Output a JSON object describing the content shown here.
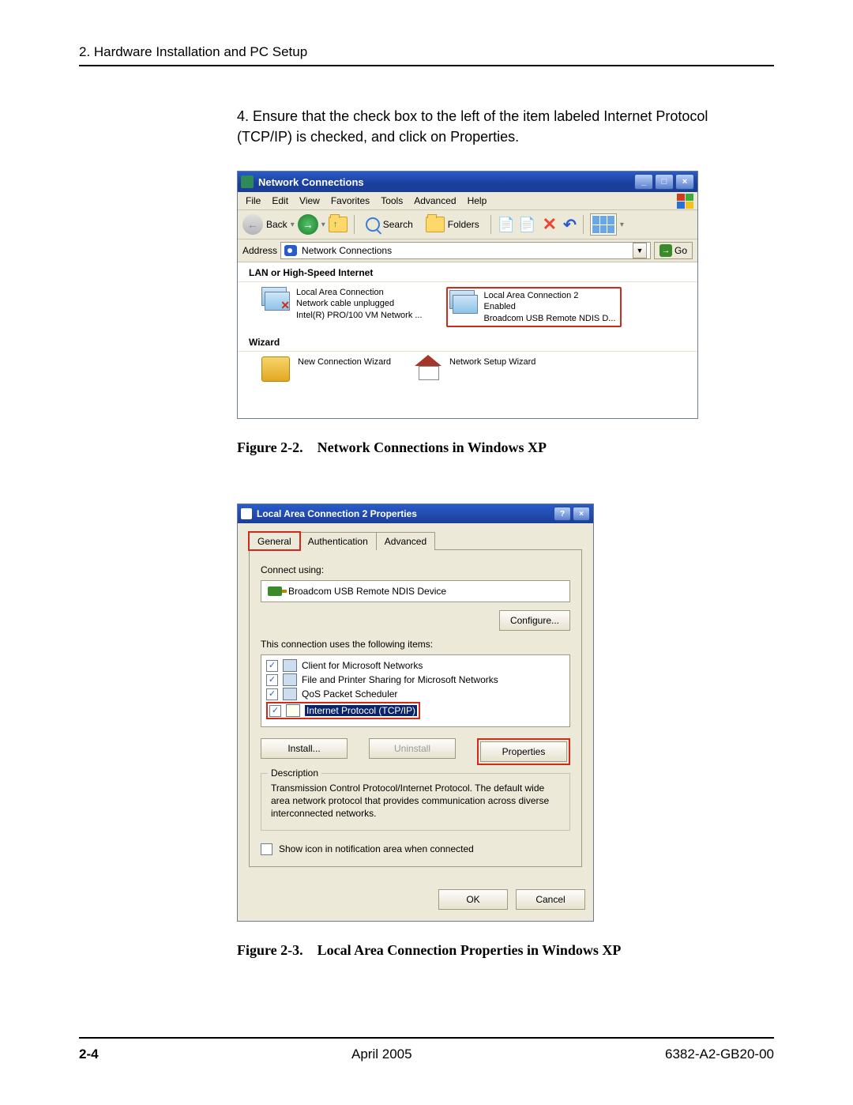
{
  "header": {
    "text": "2. Hardware Installation and PC Setup"
  },
  "instruction": {
    "number": "4.",
    "text": "Ensure that the check box to the left of the item labeled Internet Protocol (TCP/IP) is checked, and click on Properties."
  },
  "nc": {
    "title": "Network Connections",
    "menu": {
      "file": "File",
      "edit": "Edit",
      "view": "View",
      "favorites": "Favorites",
      "tools": "Tools",
      "advanced": "Advanced",
      "help": "Help"
    },
    "toolbar": {
      "back": "Back",
      "search": "Search",
      "folders": "Folders"
    },
    "address": {
      "label": "Address",
      "value": "Network Connections",
      "go": "Go"
    },
    "section_lan": "LAN or High-Speed Internet",
    "lan1": {
      "name": "Local Area Connection",
      "status": "Network cable unplugged",
      "device": "Intel(R) PRO/100 VM Network ..."
    },
    "lan2": {
      "name": "Local Area Connection 2",
      "status": "Enabled",
      "device": "Broadcom USB Remote NDIS D..."
    },
    "section_wizard": "Wizard",
    "wiz_new": "New Connection Wizard",
    "wiz_net": "Network Setup Wizard"
  },
  "caption1": {
    "label": "Figure 2-2.",
    "text": "Network Connections in Windows XP"
  },
  "prop": {
    "title": "Local Area Connection 2 Properties",
    "tabs": {
      "general": "General",
      "auth": "Authentication",
      "adv": "Advanced"
    },
    "connect_using": "Connect using:",
    "adapter": "Broadcom USB Remote NDIS Device",
    "configure": "Configure...",
    "items_label": "This connection uses the following items:",
    "items": {
      "client": "Client for Microsoft Networks",
      "fps": "File and Printer Sharing for Microsoft Networks",
      "qos": "QoS Packet Scheduler",
      "tcpip": "Internet Protocol (TCP/IP)"
    },
    "install": "Install...",
    "uninstall": "Uninstall",
    "properties": "Properties",
    "desc_title": "Description",
    "desc_text": "Transmission Control Protocol/Internet Protocol. The default wide area network protocol that provides communication across diverse interconnected networks.",
    "notify": "Show icon in notification area when connected",
    "ok": "OK",
    "cancel": "Cancel"
  },
  "caption2": {
    "label": "Figure 2-3.",
    "text": "Local Area Connection Properties in Windows XP"
  },
  "footer": {
    "page": "2-4",
    "date": "April 2005",
    "doc": "6382-A2-GB20-00"
  }
}
